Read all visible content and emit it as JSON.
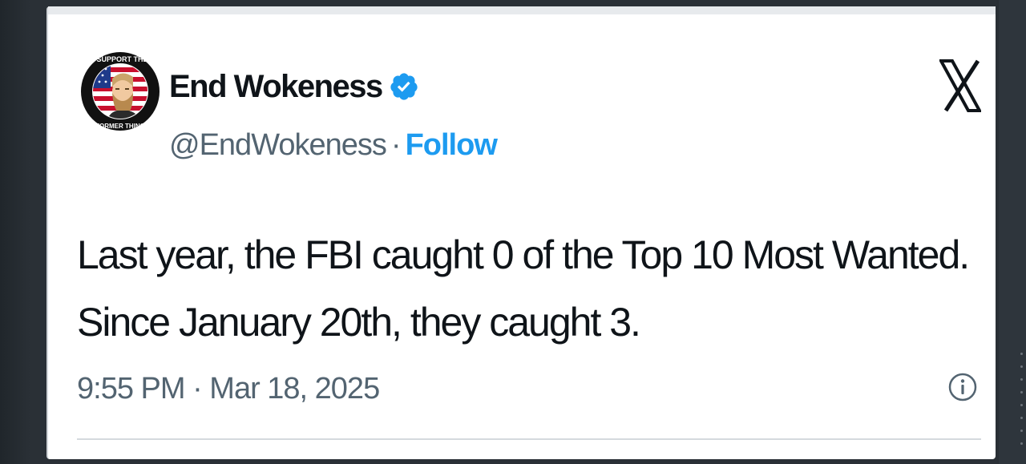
{
  "tweet": {
    "author": {
      "display_name": "End Wokeness",
      "handle": "@EndWokeness",
      "verified": true,
      "avatar_text_top": "I SUPPORT THE",
      "avatar_text_bottom": "FORMER THING"
    },
    "separator": "·",
    "follow_label": "Follow",
    "text_lines": [
      "Last year, the FBI caught 0 of the Top 10 Most Wanted.",
      "Since January 20th, they caught 3."
    ],
    "timestamp": "9:55 PM · Mar 18, 2025",
    "icons": {
      "platform": "x-logo-icon",
      "verified": "verified-badge-icon",
      "info": "info-icon"
    },
    "colors": {
      "follow": "#1d9bf0",
      "text": "#0f1419",
      "muted": "#536471",
      "verified": "#1d9bf0"
    }
  }
}
